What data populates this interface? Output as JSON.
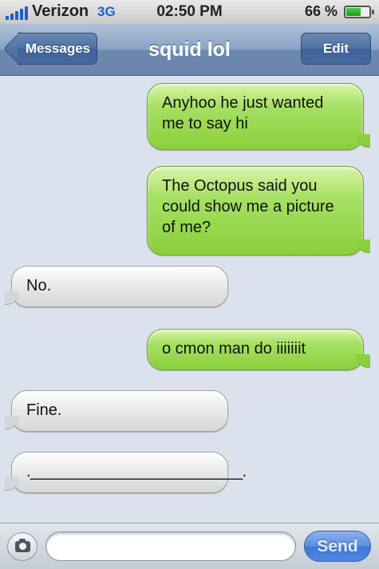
{
  "status_bar": {
    "carrier": "Verizon",
    "network": "3G",
    "time": "02:50 PM",
    "battery_label": "66 %",
    "battery_level": 0.66,
    "signal_icon": "signal-bars-icon",
    "battery_icon": "battery-icon"
  },
  "nav_bar": {
    "back_label": "Messages",
    "title": "squid lol",
    "edit_label": "Edit"
  },
  "messages": [
    {
      "from": "me",
      "text": "Anyhoo he just wanted me to say hi"
    },
    {
      "from": "me",
      "text": "The Octopus said you could show me a picture of me?"
    },
    {
      "from": "them",
      "text": "No."
    },
    {
      "from": "me",
      "text": "o cmon man do iiiiiiit"
    },
    {
      "from": "them",
      "text": "Fine."
    },
    {
      "from": "them",
      "text": "._________________________."
    }
  ],
  "composer": {
    "camera_icon": "camera-icon",
    "input_value": "",
    "input_placeholder": "",
    "send_label": "Send"
  },
  "colors": {
    "sent_bubble": "#8ccf3c",
    "received_bubble": "#e6e6e6",
    "nav_bar": "#7f9bc0",
    "send_button": "#4f86e0"
  }
}
